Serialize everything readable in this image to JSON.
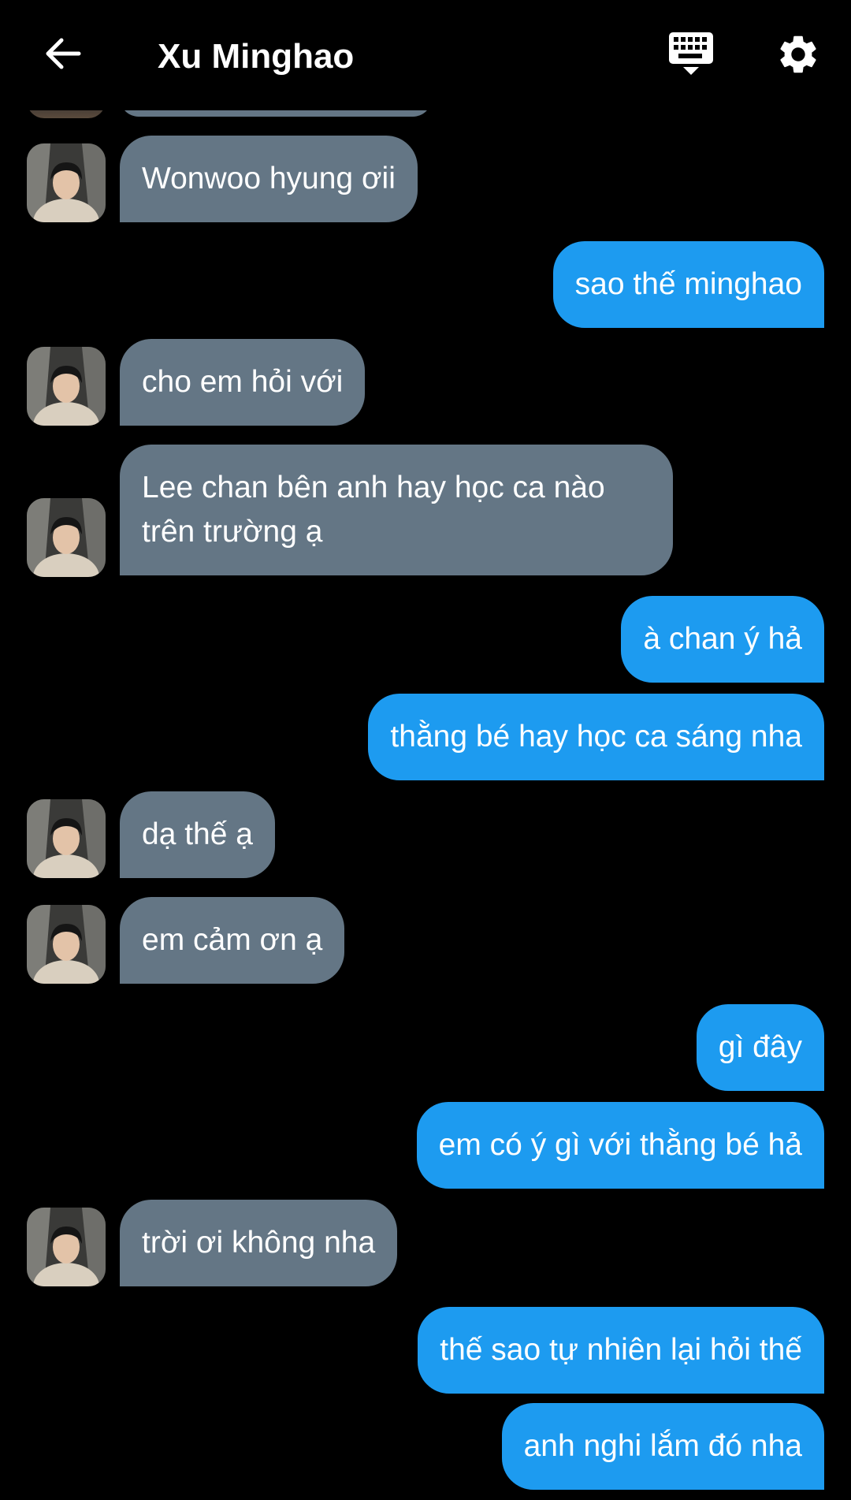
{
  "header": {
    "title": "Xu Minghao",
    "back_icon": "arrow-left-icon",
    "keyboard_icon": "keyboard-icon",
    "settings_icon": "gear-icon"
  },
  "colors": {
    "incoming_bubble": "#647685",
    "outgoing_bubble": "#1d9bf0",
    "background": "#000000"
  },
  "messages": [
    {
      "from": "them",
      "text": "Wonwoo hyung ơii"
    },
    {
      "from": "me",
      "text": "sao thế minghao"
    },
    {
      "from": "them",
      "text": "cho em hỏi với"
    },
    {
      "from": "them",
      "text": "Lee chan bên anh hay học ca nào trên trường ạ"
    },
    {
      "from": "me",
      "text": "à chan ý hả"
    },
    {
      "from": "me",
      "text": "thằng bé hay học ca sáng nha"
    },
    {
      "from": "them",
      "text": "dạ thế ạ"
    },
    {
      "from": "them",
      "text": "em cảm ơn ạ"
    },
    {
      "from": "me",
      "text": "gì đây"
    },
    {
      "from": "me",
      "text": "em có ý gì với thằng bé hả"
    },
    {
      "from": "them",
      "text": "trời ơi không nha"
    },
    {
      "from": "me",
      "text": "thế sao tự nhiên lại hỏi thế"
    },
    {
      "from": "me",
      "text": "anh nghi lắm đó nha"
    }
  ]
}
